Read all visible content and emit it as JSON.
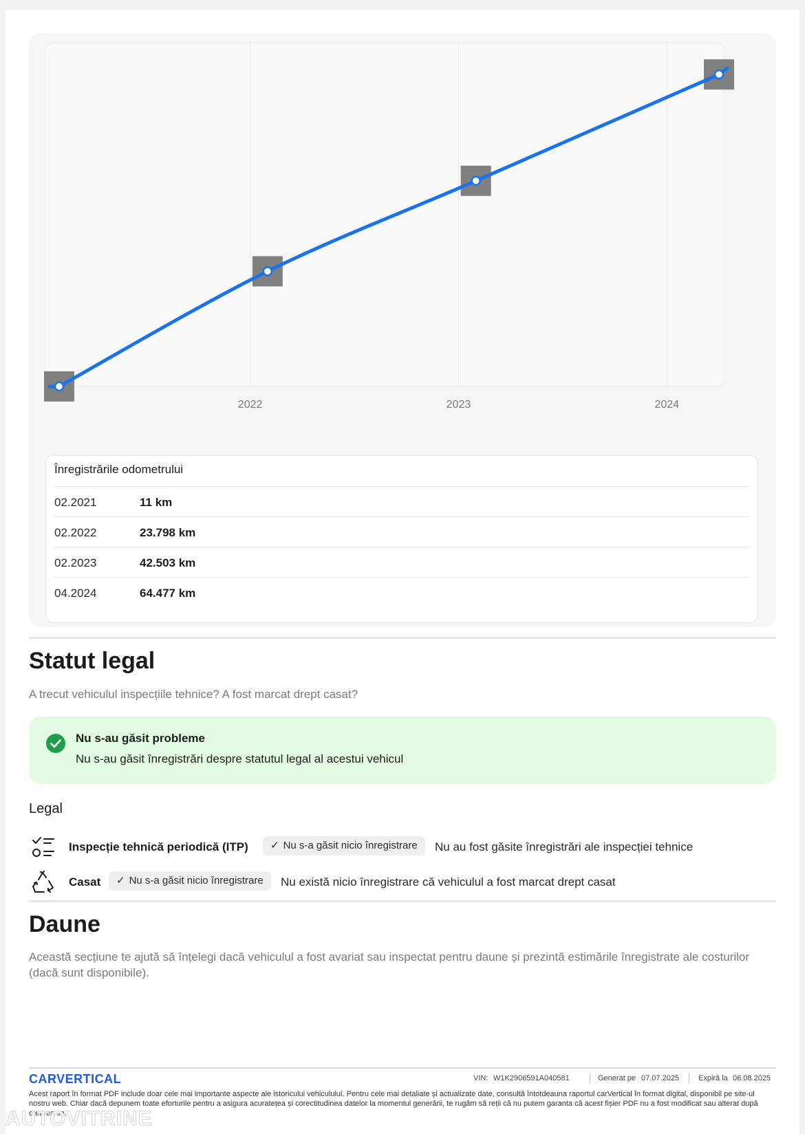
{
  "chart_data": {
    "type": "line",
    "x_ticks": [
      "2022",
      "2023",
      "2024"
    ],
    "points": [
      {
        "date": "02.2021",
        "km": 11
      },
      {
        "date": "02.2022",
        "km": 23798
      },
      {
        "date": "02.2023",
        "km": 42503
      },
      {
        "date": "04.2024",
        "km": 64477
      }
    ],
    "line_color": "#1a73e8",
    "grid": true
  },
  "odometer": {
    "title": "Înregistrările odometrului",
    "rows": [
      {
        "date": "02.2021",
        "km": "11 km"
      },
      {
        "date": "02.2022",
        "km": "23.798 km"
      },
      {
        "date": "02.2023",
        "km": "42.503 km"
      },
      {
        "date": "04.2024",
        "km": "64.477 km"
      }
    ]
  },
  "legal_status": {
    "title": "Statut legal",
    "subtitle": "A trecut vehiculul inspecțiile tehnice? A fost marcat drept casat?",
    "ok_title": "Nu s-au găsit probleme",
    "ok_text": "Nu s-au găsit înregistrări despre statutul legal al acestui vehicul",
    "section_label": "Legal",
    "items": [
      {
        "label": "Inspecție tehnică periodică (ITP)",
        "badge": "Nu s-a găsit nicio înregistrare",
        "desc": "Nu au fost găsite înregistrări ale inspecției tehnice",
        "icon": "checklist-icon"
      },
      {
        "label": "Casat",
        "badge": "Nu s-a găsit nicio înregistrare",
        "desc": "Nu există nicio înregistrare că vehiculul a fost marcat drept casat",
        "icon": "recycle-icon"
      }
    ]
  },
  "damage": {
    "title": "Daune",
    "subtitle": "Această secțiune te ajută să înțelegi dacă vehiculul a fost avariat sau inspectat pentru daune și prezintă estimările înregistrate ale costurilor (dacă sunt disponibile)."
  },
  "footer": {
    "logo": "CARVERTICAL",
    "vin_label": "VIN:",
    "vin": "W1K2906591A040581",
    "generated_label": "Generat pe",
    "generated": "07.07.2025",
    "expires_label": "Expiră la",
    "expires": "06.08.2025",
    "disclaimer": "Acest raport în format PDF include doar cele mai importante aspecte ale istoricului vehiculului. Pentru cele mai detaliate și actualizate date, consultă întotdeauna raportul carVertical în format digital, disponibil pe site-ul nostru web. Chiar dacă depunem toate eforturile pentru a asigura acuratețea și corectitudinea datelor la momentul generării, te rugăm să reții că nu putem garanta că acest fișier PDF nu a fost modificat sau alterat după crearea sa.",
    "watermark": "AUTOVITRINE"
  },
  "colors": {
    "accent": "#1a73e8",
    "success_bg": "#e3fbe3",
    "success_icon": "#1e9e4a",
    "logo": "#1f5ad9"
  }
}
